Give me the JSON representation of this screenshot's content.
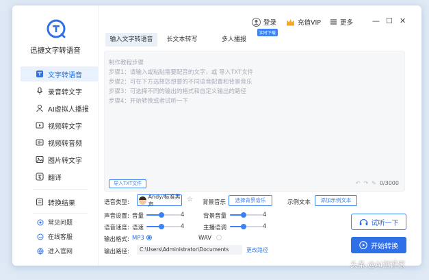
{
  "app": {
    "title": "迅捷文字转语音"
  },
  "sidebar": {
    "items": [
      {
        "label": "文字转语音",
        "icon": "text-to-speech-icon",
        "active": true
      },
      {
        "label": "录音转文字",
        "icon": "recording-icon"
      },
      {
        "label": "AI虚拟人播报",
        "icon": "ai-avatar-icon"
      },
      {
        "label": "视频转文字",
        "icon": "video-icon"
      },
      {
        "label": "视频转音频",
        "icon": "video-audio-icon"
      },
      {
        "label": "图片转文字",
        "icon": "image-icon"
      },
      {
        "label": "翻译",
        "icon": "translate-icon"
      }
    ],
    "results_label": "转换结果",
    "footer": [
      {
        "label": "常见问题",
        "icon": "help-icon"
      },
      {
        "label": "在线客服",
        "icon": "support-icon"
      },
      {
        "label": "进入官网",
        "icon": "website-icon"
      }
    ]
  },
  "topbar": {
    "login": "登录",
    "vip": "充值VIP",
    "more": "更多",
    "minimize": "—",
    "maximize": "☐",
    "close": "✕"
  },
  "tabs": [
    {
      "label": "输入文字转语音",
      "active": true
    },
    {
      "label": "长文本转写"
    },
    {
      "label": "多人播报"
    }
  ],
  "tab_badge": "实时下载",
  "editor": {
    "title": "制作教程步骤",
    "steps": [
      "步骤1：请输入或粘贴需要配音的文字，或 导入TXT文件",
      "步骤2：可在下方选择您想要的不同语音配置和背景音乐",
      "步骤3：可选择不同的输出的格式和自定义输出的路径",
      "步骤4：开始转换或者试听一下"
    ],
    "import_button": "导入TXT文件",
    "counter": "0/3000"
  },
  "settings": {
    "voice_type_label": "语音类型:",
    "voice_name": "Andy/标准男声",
    "bg_music_label": "背景音乐",
    "bg_music_button": "选择背景音乐",
    "sample_label": "示例文本",
    "sample_button": "添加示例文本",
    "sound_settings_label": "声音设置:",
    "volume_label": "音量",
    "volume_value": "4",
    "bg_volume_label": "背景音量",
    "bg_volume_value": "4",
    "speed_label_row": "语音速度:",
    "speed_label": "语速",
    "speed_value": "4",
    "main_speed_label": "主播语调",
    "main_speed_value": "4",
    "output_format_label": "输出格式:",
    "format_mp3": "MP3",
    "format_wav": "WAV",
    "output_path_label": "输出路径:",
    "output_path": "C:\\Users\\Administrator\\Documents",
    "change_path": "更改路径"
  },
  "actions": {
    "listen": "试听一下",
    "start": "开始转换"
  },
  "watermark": "头条 @AI测评家",
  "colors": {
    "accent": "#2f6fe8",
    "active_bg": "#e9f1fd"
  }
}
